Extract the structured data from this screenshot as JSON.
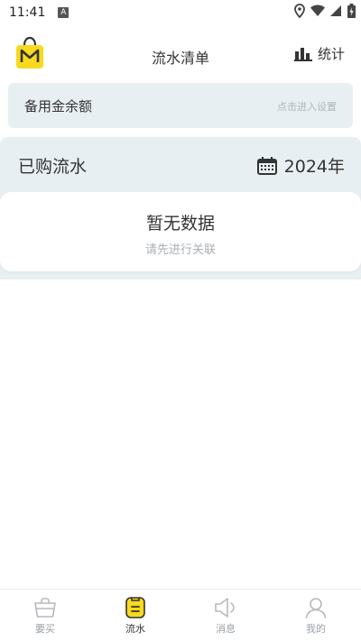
{
  "status_bar": {
    "time": "11:41",
    "notification_icon": "A"
  },
  "header": {
    "title": "流水清单",
    "stats_label": "统计"
  },
  "backup": {
    "label": "备用金余额",
    "action": "点击进入设置"
  },
  "flow": {
    "title": "已购流水",
    "year": "2024年"
  },
  "empty": {
    "title": "暂无数据",
    "subtitle": "请先进行关联"
  },
  "tabs": [
    {
      "label": "要买",
      "icon": "basket-icon",
      "active": false
    },
    {
      "label": "流水",
      "icon": "list-icon",
      "active": true
    },
    {
      "label": "消息",
      "icon": "speaker-icon",
      "active": false
    },
    {
      "label": "我的",
      "icon": "user-icon",
      "active": false
    }
  ],
  "colors": {
    "accent": "#f7d91e",
    "panel_bg": "#e8eff2",
    "muted_text": "#aab0b4"
  }
}
